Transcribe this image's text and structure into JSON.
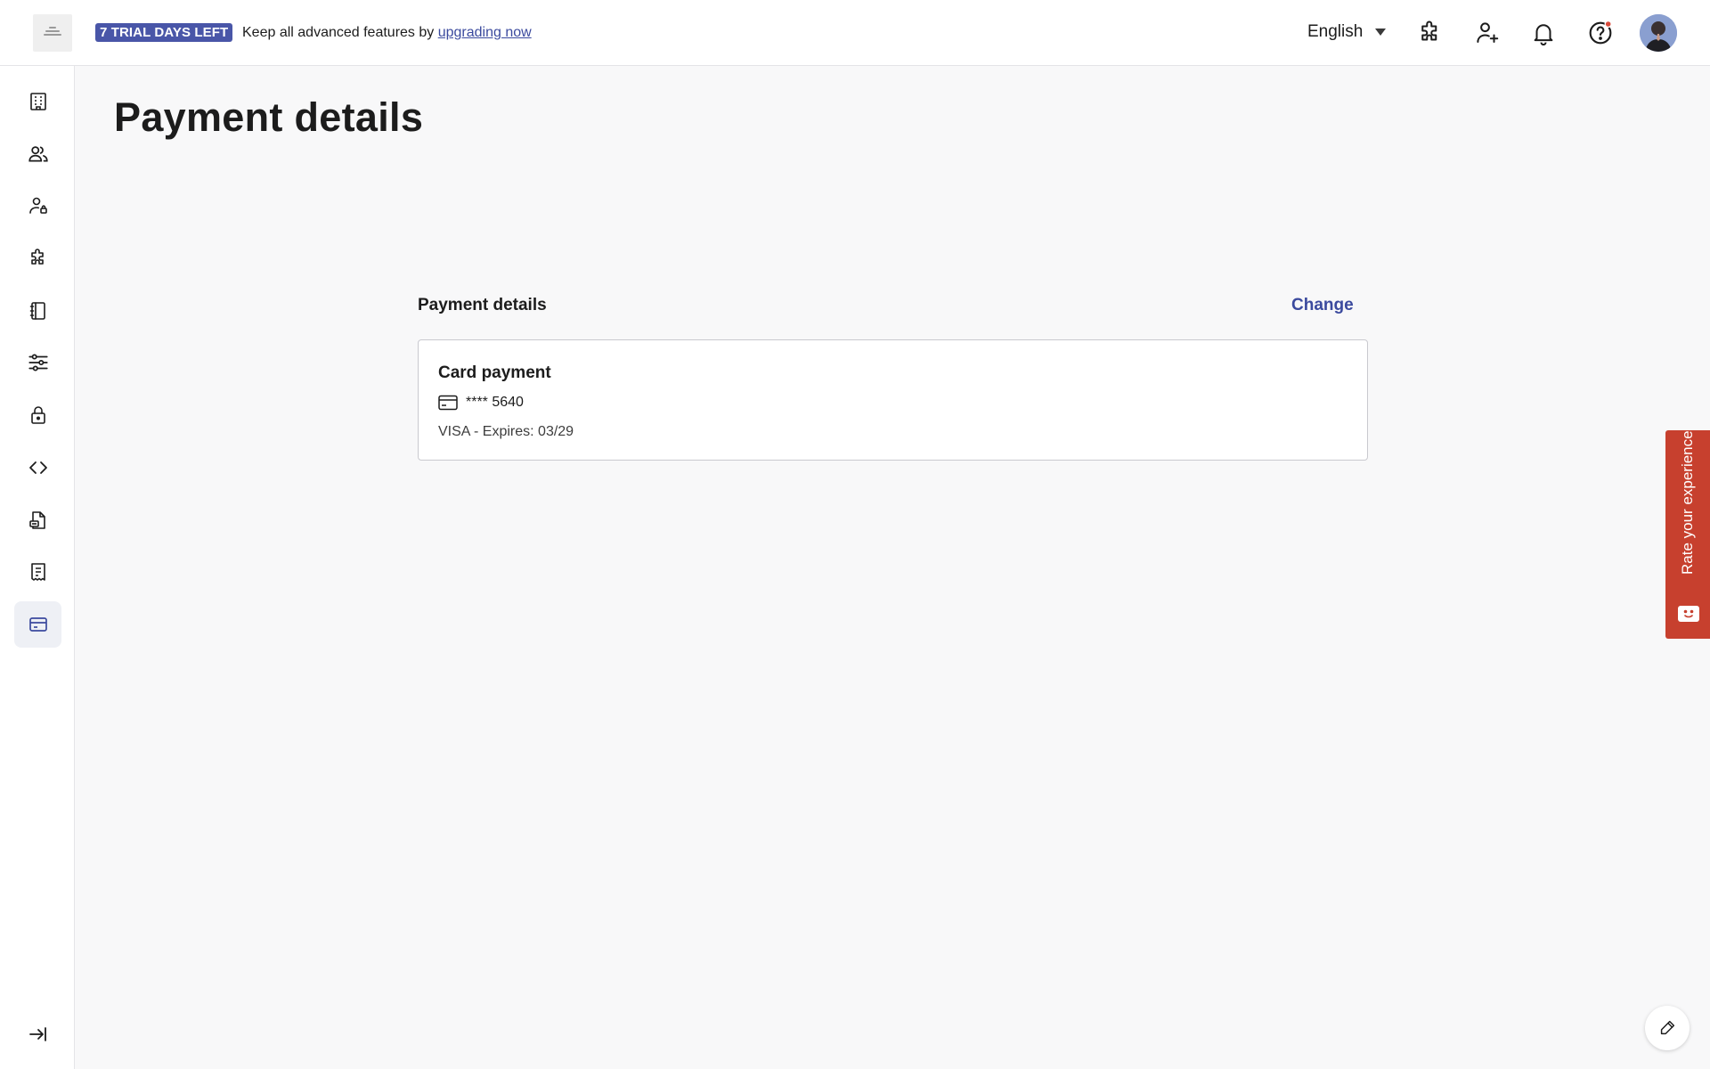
{
  "header": {
    "trial_badge": "7 TRIAL DAYS LEFT",
    "trial_text": "Keep all advanced features by ",
    "trial_link": "upgrading now",
    "language": "English",
    "icons": [
      "integrations-icon",
      "add-user-icon",
      "bell-icon",
      "help-icon",
      "avatar"
    ]
  },
  "sidebar": {
    "items": [
      {
        "icon": "building-icon",
        "active": false
      },
      {
        "icon": "users-icon",
        "active": false
      },
      {
        "icon": "user-lock-icon",
        "active": false
      },
      {
        "icon": "puzzle-icon",
        "active": false
      },
      {
        "icon": "notebook-icon",
        "active": false
      },
      {
        "icon": "sliders-icon",
        "active": false
      },
      {
        "icon": "lock-icon",
        "active": false
      },
      {
        "icon": "code-icon",
        "active": false
      },
      {
        "icon": "document-icon",
        "active": false
      },
      {
        "icon": "receipt-icon",
        "active": false
      },
      {
        "icon": "credit-card-icon",
        "active": true
      }
    ],
    "collapse_icon": "collapse-sidebar-icon"
  },
  "main": {
    "title": "Payment details",
    "section_title": "Payment details",
    "change_label": "Change",
    "card": {
      "title": "Card payment",
      "number": "**** 5640",
      "details": "VISA - Expires: 03/29"
    }
  },
  "feedback": {
    "label": "Rate your experience"
  },
  "colors": {
    "accent": "#3b4a9e",
    "badge": "#4956a8",
    "feedback": "#c7402e"
  }
}
